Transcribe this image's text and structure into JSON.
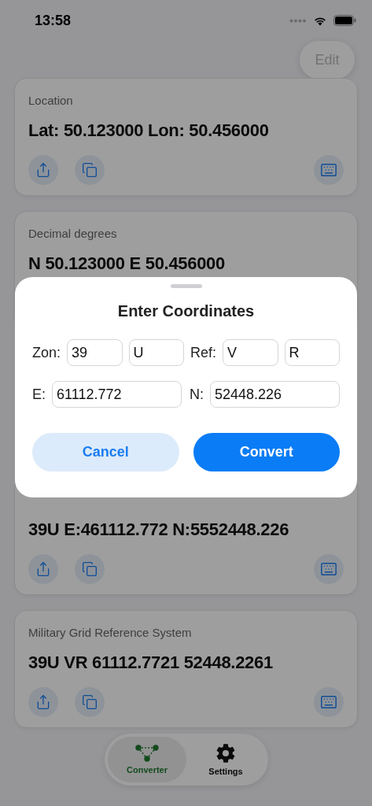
{
  "status_bar": {
    "time": "13:58"
  },
  "toolbar": {
    "edit_button": "Edit"
  },
  "cards": [
    {
      "kind": "card",
      "title": "Location",
      "value": "Lat: 50.123000 Lon: 50.456000"
    },
    {
      "kind": "bottom_covered",
      "title": "Decimal degrees",
      "value": "N 50.123000 E 50.456000"
    },
    {
      "kind": "covered"
    },
    {
      "kind": "top_covered",
      "value": "39U E:461112.772 N:5552448.226"
    },
    {
      "kind": "card",
      "title": "Military Grid Reference System",
      "value": "39U VR 61112.7721 52448.2261"
    }
  ],
  "dialog": {
    "title": "Enter Coordinates",
    "zone_label": "Zon:",
    "zone_fields": [
      "39",
      "U"
    ],
    "ref_label": "Ref:",
    "ref_fields": [
      "V",
      "R"
    ],
    "easting_label": "E:",
    "easting": "61112.772",
    "northing_label": "N:",
    "northing": "52448.226",
    "cancel_button": "Cancel",
    "convert_button": "Convert"
  },
  "tab_bar": [
    {
      "kind": "converter",
      "label": "Converter",
      "selected": true
    },
    {
      "kind": "settings",
      "label": "Settings",
      "selected": false
    }
  ]
}
